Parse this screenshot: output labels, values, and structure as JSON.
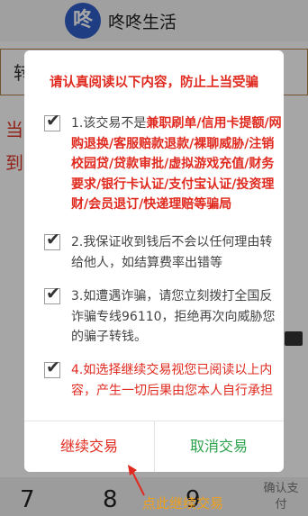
{
  "app": {
    "logo_char": "咚",
    "name": "咚咚生活"
  },
  "background": {
    "input_text": "转",
    "warn_line1": "当",
    "warn_line2": "到",
    "keys": [
      "7",
      "8",
      "9"
    ],
    "confirm_label": "确认支付"
  },
  "dialog": {
    "title": "请认真阅读以下内容，防止上当受骗",
    "items": [
      {
        "text": "1.该交易不是兼职刷单/信用卡提额/网购退换/客服赔款退款/裸聊威胁/注销校园贷/贷款审批/虚拟游戏充值/财务要求/银行卡认证/支付宝认证/投资理财/会员退订/快递理赔等骗局",
        "checked": true,
        "color": "#444444"
      },
      {
        "text": "2.我保证收到钱后不会以任何理由转给他人，如结算费率出错等",
        "checked": true,
        "color": "#444444"
      },
      {
        "text": "3.如遭遇诈骗，请您立刻拨打全国反诈骗专线96110，拒绝再次向威胁您的骗子转钱。",
        "checked": true,
        "color": "#444444"
      },
      {
        "text": "4.如选择继续交易视您已阅读以上内容，产生一切后果由您本人自行承担",
        "checked": true,
        "color": "#e02a1f"
      }
    ],
    "continue_label": "继续交易",
    "cancel_label": "取消交易"
  },
  "annotation": {
    "hint": "点此继续交易"
  },
  "colors": {
    "red": "#e02a1f",
    "green": "#2ba24c",
    "hint": "#f0a01a",
    "brand": "#2f5ec8"
  }
}
